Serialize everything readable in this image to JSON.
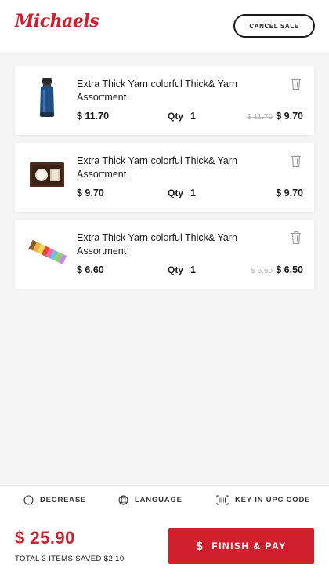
{
  "header": {
    "brand": "Michaels",
    "cancel_label": "CANCEL SALE"
  },
  "cart": {
    "qty_label": "Qty",
    "items": [
      {
        "title": "Extra Thick Yarn colorful Thick& Yarn Assortment",
        "price": "$ 11.70",
        "qty": "1",
        "original_price": "$ 11.70",
        "final_price": "$ 9.70",
        "image": "water-bottle"
      },
      {
        "title": "Extra Thick Yarn colorful Thick& Yarn Assortment",
        "price": "$ 9.70",
        "qty": "1",
        "original_price": "",
        "final_price": "$ 9.70",
        "image": "photo-frame"
      },
      {
        "title": "Extra Thick Yarn colorful Thick& Yarn Assortment",
        "price": "$ 6.60",
        "qty": "1",
        "original_price": "$ 6.60",
        "final_price": "$ 6.50",
        "image": "color-blocks"
      }
    ]
  },
  "toolbar": {
    "decrease_label": "DECREASE",
    "language_label": "LANGUAGE",
    "upc_label": "KEY IN UPC CODE"
  },
  "footer": {
    "total": "$ 25.90",
    "summary": "TOTAL 3 ITEMS SAVED $2.10",
    "pay_label": "FINISH & PAY"
  },
  "colors": {
    "accent": "#d0202e",
    "background": "#f5f5f5"
  }
}
